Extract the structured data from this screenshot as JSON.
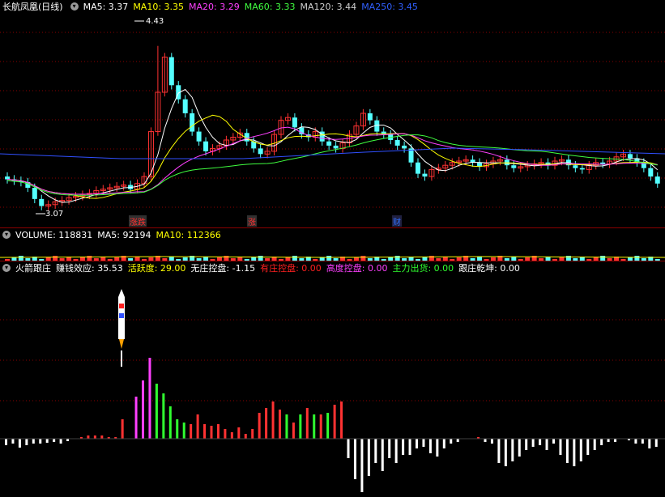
{
  "main": {
    "title": "长航凤凰(日线)",
    "indicators": [
      {
        "label": "MA5: 3.37",
        "color": "#ffffff"
      },
      {
        "label": "MA10: 3.35",
        "color": "#ffff00"
      },
      {
        "label": "MA20: 3.29",
        "color": "#ff40ff"
      },
      {
        "label": "MA60: 3.33",
        "color": "#40ff40"
      },
      {
        "label": "MA120: 3.44",
        "color": "#d0d0d0"
      },
      {
        "label": "MA250: 3.45",
        "color": "#3060ff"
      }
    ],
    "high_label": "4.43",
    "low_label": "3.07",
    "event_tags": [
      {
        "text": "涨跌",
        "color": "#ff3030"
      },
      {
        "text": "涨",
        "color": "#ff3030"
      },
      {
        "text": "财",
        "color": "#3070ff"
      }
    ]
  },
  "volume": {
    "title": "VOLUME: 118831",
    "indicators": [
      {
        "label": "MA5: 92194",
        "color": "#ffffff"
      },
      {
        "label": "MA10: 112366",
        "color": "#ffff00"
      }
    ]
  },
  "rocket": {
    "title": "火箭跟庄",
    "indicators": [
      {
        "label": "赚钱效应: 35.53",
        "color": "#ffffff"
      },
      {
        "label": "活跃度: 29.00",
        "color": "#ffff00"
      },
      {
        "label": "无庄控盘: -1.15",
        "color": "#ffffff"
      },
      {
        "label": "有庄控盘: 0.00",
        "color": "#ff2020"
      },
      {
        "label": "高度控盘: 0.00",
        "color": "#ff40ff"
      },
      {
        "label": "主力出货: 0.00",
        "color": "#30ff30"
      },
      {
        "label": "跟庄乾坤: 0.00",
        "color": "#ffffff"
      }
    ]
  },
  "colors": {
    "up": "#ff3232",
    "down": "#54ffff",
    "grid": "#8b0000"
  }
}
